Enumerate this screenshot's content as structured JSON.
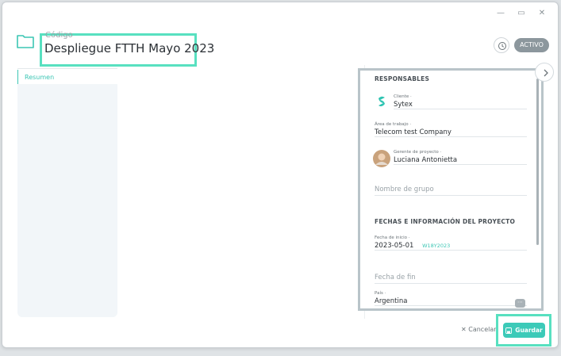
{
  "header": {
    "code_label": "Código",
    "title": "Despliegue FTTH Mayo 2023",
    "status": "ACTIVO"
  },
  "tabs": [
    {
      "label": "Resumen"
    }
  ],
  "side": {
    "responsables_title": "RESPONSABLES",
    "client_label": "Cliente",
    "client_value": "Sytex",
    "area_label": "Área de trabajo",
    "area_value": "Telecom test Company",
    "manager_label": "Gerente de proyecto",
    "manager_value": "Luciana Antonietta",
    "group_placeholder": "Nombre de grupo",
    "dates_title": "FECHAS E INFORMACIÓN DEL PROYECTO",
    "start_label": "Fecha de inicio",
    "start_value": "2023-05-01",
    "start_week": "W18Y2023",
    "end_placeholder": "Fecha de fin",
    "country_label": "País",
    "country_value": "Argentina"
  },
  "footer": {
    "cancel_label": "Cancelar",
    "save_label": "Guardar"
  },
  "colors": {
    "accent": "#3ccab8",
    "highlight": "#58e0c0",
    "badge": "#8c979d"
  }
}
